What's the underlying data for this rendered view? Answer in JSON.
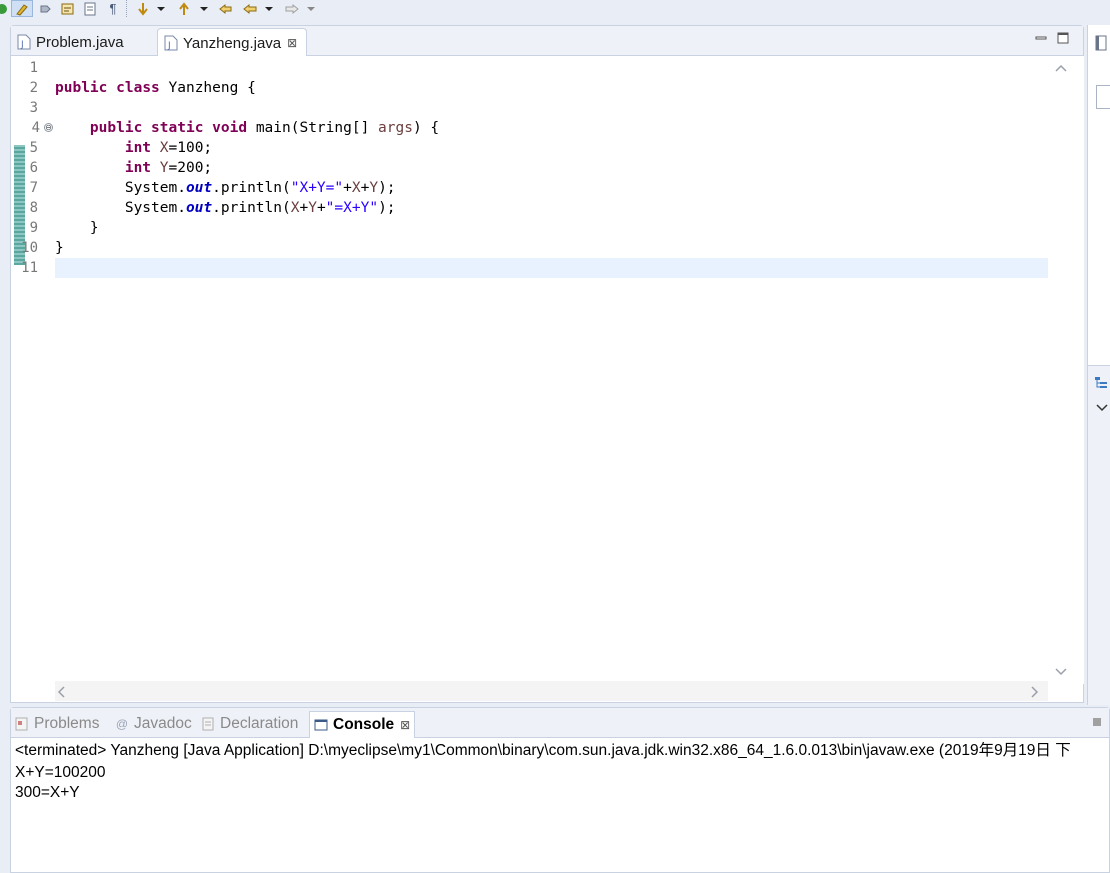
{
  "toolbar": {
    "icons": [
      "run-icon",
      "highlight-icon",
      "pin-icon",
      "annotation-icon",
      "task-icon",
      "pilcrow-icon",
      "next-annotation-icon",
      "dropdown-icon",
      "prev-annotation-icon",
      "dropdown-icon",
      "last-edit-icon",
      "back-icon",
      "dropdown-icon",
      "forward-icon",
      "dropdown-icon"
    ],
    "pilcrow": "¶"
  },
  "editor": {
    "tabs": [
      {
        "label": "Problem.java",
        "active": false
      },
      {
        "label": "Yanzheng.java",
        "active": true,
        "close": "⊠"
      }
    ],
    "line_numbers": [
      "1",
      "2",
      "3",
      "4",
      "5",
      "6",
      "7",
      "8",
      "9",
      "10",
      "11"
    ],
    "fold_marker": "⊖",
    "code": {
      "l2_kw1": "public",
      "l2_kw2": "class",
      "l2_rest": " Yanzheng {",
      "l4_kw1": "public",
      "l4_kw2": "static",
      "l4_kw3": "void",
      "l4_mid": " main(String[] ",
      "l4_var": "args",
      "l4_end": ") {",
      "l5_kw": "int",
      "l5_var": "X",
      "l5_rest": "=100;",
      "l6_kw": "int",
      "l6_var": "Y",
      "l6_rest": "=200;",
      "l7_a": "System.",
      "l7_fld": "out",
      "l7_b": ".println(",
      "l7_str": "\"X+Y=\"",
      "l7_c": "+",
      "l7_v1": "X",
      "l7_d": "+",
      "l7_v2": "Y",
      "l7_e": ");",
      "l8_a": "System.",
      "l8_fld": "out",
      "l8_b": ".println(",
      "l8_v1": "X",
      "l8_c": "+",
      "l8_v2": "Y",
      "l8_d": "+",
      "l8_str": "\"=X+Y\"",
      "l8_e": ");",
      "l9": "    }",
      "l10": "}"
    },
    "current_line": 11
  },
  "views": {
    "tabs": [
      {
        "label": "Problems",
        "icon": "problems-icon",
        "active": false
      },
      {
        "label": "Javadoc",
        "icon": "at-icon",
        "active": false
      },
      {
        "label": "Declaration",
        "icon": "declaration-icon",
        "active": false
      },
      {
        "label": "Console",
        "icon": "console-icon",
        "active": true,
        "close": "⊠"
      }
    ]
  },
  "console": {
    "header": "<terminated> Yanzheng [Java Application] D:\\myeclipse\\my1\\Common\\binary\\com.sun.java.jdk.win32.x86_64_1.6.0.013\\bin\\javaw.exe (2019年9月19日 下",
    "output": [
      "X+Y=100200",
      "300=X+Y"
    ]
  },
  "colors": {
    "keyword": "#7f0055",
    "string": "#2a00ff",
    "field": "#0000c0",
    "variable": "#6a3e3e",
    "current_line": "#e8f2fe",
    "change_bar": "#5aa7a0"
  }
}
